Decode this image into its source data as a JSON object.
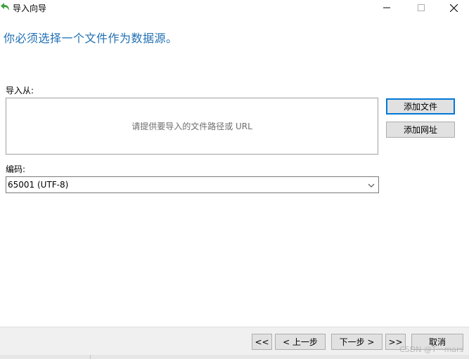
{
  "window": {
    "title": "导入向导",
    "icon": "back-arrow-icon"
  },
  "main": {
    "heading": "你必须选择一个文件作为数据源。",
    "import_from_label": "导入从:",
    "file_placeholder": "请提供要导入的文件路径或 URL",
    "add_file_label": "添加文件",
    "add_url_label": "添加网址",
    "encoding_label": "编码:",
    "encoding_value": "65001 (UTF-8)"
  },
  "footer": {
    "first_label": "<<",
    "prev_label": "< 上一步",
    "next_label": "下一步 >",
    "last_label": ">>",
    "cancel_label": "取消"
  },
  "watermark": "CSDN @T一mars",
  "colors": {
    "heading": "#1f6fb3",
    "accent_border": "#0078d7",
    "footer_bg": "#f0f0f0",
    "button_bg": "#e1e1e1"
  }
}
